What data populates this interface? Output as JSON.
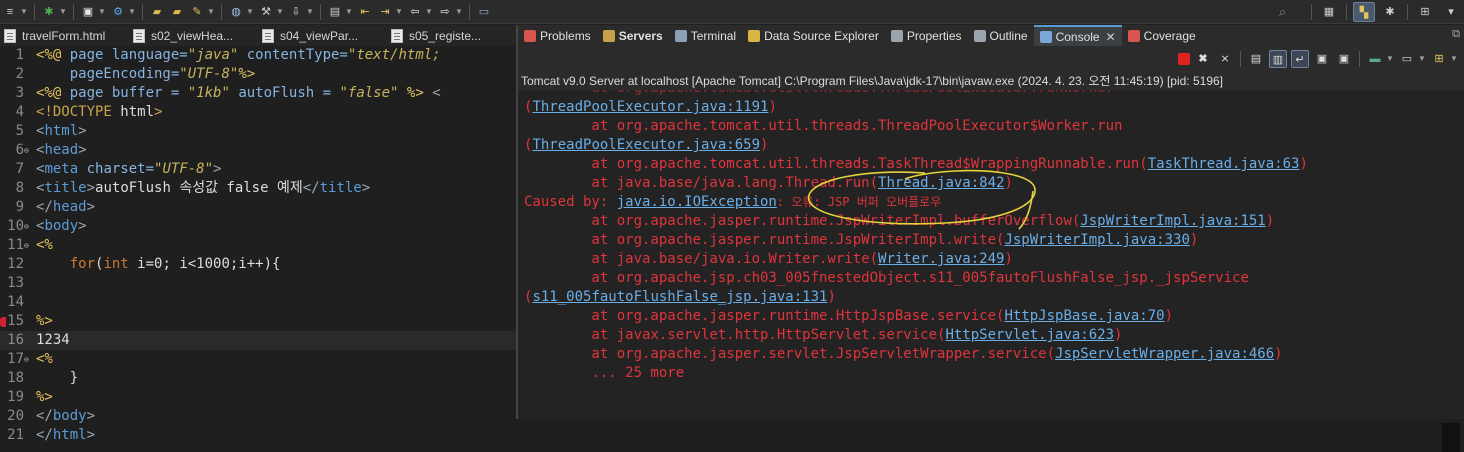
{
  "toolbar": {
    "left_icons": [
      "menu-icon",
      "debug-icon",
      "new-icon",
      "run-icon",
      "open-folder-icon",
      "open-file-icon",
      "brush-icon",
      "globe-icon",
      "tools-icon",
      "import-icon",
      "export-icon",
      "back-icon",
      "forward-icon",
      "prev-icon",
      "next-icon",
      "view-icon"
    ],
    "right_icons": [
      "search-icon",
      "perspective-icon",
      "java-ee-perspective-icon",
      "debug-perspective-icon",
      "add-perspective-icon",
      "more-icon"
    ]
  },
  "editor_tabs": [
    {
      "label": "travelForm.html"
    },
    {
      "label": "s02_viewHea..."
    },
    {
      "label": "s04_viewPar..."
    },
    {
      "label": "s05_registe..."
    }
  ],
  "editor": {
    "lines": [
      {
        "n": "1",
        "fold": "",
        "tokens": [
          [
            "k-jsp",
            "<%@ "
          ],
          [
            "k-attr",
            "page language="
          ],
          [
            "k-str",
            "\"java\""
          ],
          [
            "k-attr",
            " contentType="
          ],
          [
            "k-str",
            "\"text/html;"
          ]
        ]
      },
      {
        "n": "2",
        "fold": "",
        "tokens": [
          [
            "k-attr",
            "    pageEncoding="
          ],
          [
            "k-str",
            "\"UTF-8\""
          ],
          [
            "k-jsp",
            "%>"
          ]
        ]
      },
      {
        "n": "3",
        "fold": "",
        "tokens": [
          [
            "k-jsp",
            "<%@ "
          ],
          [
            "k-attr",
            "page buffer = "
          ],
          [
            "k-str",
            "\"1kb\""
          ],
          [
            "k-attr",
            " autoFlush = "
          ],
          [
            "k-str",
            "\"false\""
          ],
          [
            "k-jsp",
            " %> "
          ],
          [
            "k-tag",
            "<"
          ]
        ]
      },
      {
        "n": "4",
        "fold": "",
        "tokens": [
          [
            "k-doc",
            "<!DOCTYPE "
          ],
          [
            "k-plain",
            "html"
          ],
          [
            "k-doc",
            ">"
          ]
        ]
      },
      {
        "n": "5",
        "fold": "",
        "tokens": [
          [
            "k-tag",
            "<"
          ],
          [
            "k-elem",
            "html"
          ],
          [
            "k-tag",
            ">"
          ]
        ]
      },
      {
        "n": "6",
        "fold": "⊖",
        "tokens": [
          [
            "k-tag",
            "<"
          ],
          [
            "k-elem",
            "head"
          ],
          [
            "k-tag",
            ">"
          ]
        ]
      },
      {
        "n": "7",
        "fold": "",
        "tokens": [
          [
            "k-tag",
            "<"
          ],
          [
            "k-elem",
            "meta "
          ],
          [
            "k-attr",
            "charset="
          ],
          [
            "k-str",
            "\"UTF-8\""
          ],
          [
            "k-tag",
            ">"
          ]
        ]
      },
      {
        "n": "8",
        "fold": "",
        "tokens": [
          [
            "k-tag",
            "<"
          ],
          [
            "k-elem",
            "title"
          ],
          [
            "k-tag",
            ">"
          ],
          [
            "k-plain",
            "autoFlush 속성값 false 예제"
          ],
          [
            "k-tag",
            "</"
          ],
          [
            "k-elem",
            "title"
          ],
          [
            "k-tag",
            ">"
          ]
        ]
      },
      {
        "n": "9",
        "fold": "",
        "tokens": [
          [
            "k-tag",
            "</"
          ],
          [
            "k-elem",
            "head"
          ],
          [
            "k-tag",
            ">"
          ]
        ]
      },
      {
        "n": "10",
        "fold": "⊖",
        "tokens": [
          [
            "k-tag",
            "<"
          ],
          [
            "k-elem",
            "body"
          ],
          [
            "k-tag",
            ">"
          ]
        ]
      },
      {
        "n": "11",
        "fold": "⊖",
        "tokens": [
          [
            "k-jsp",
            "<%"
          ]
        ]
      },
      {
        "n": "12",
        "fold": "",
        "tokens": [
          [
            "k-plain",
            "    "
          ],
          [
            "k-kw",
            "for"
          ],
          [
            "k-plain",
            "("
          ],
          [
            "k-kw",
            "int"
          ],
          [
            "k-plain",
            " i=0; i<1000;i++){"
          ]
        ]
      },
      {
        "n": "13",
        "fold": "",
        "tokens": []
      },
      {
        "n": "14",
        "fold": "",
        "tokens": []
      },
      {
        "n": "15",
        "fold": "",
        "tokens": [
          [
            "k-jsp",
            "%>"
          ]
        ]
      },
      {
        "n": "16",
        "fold": "",
        "tokens": [
          [
            "k-plain",
            "1234"
          ]
        ]
      },
      {
        "n": "17",
        "fold": "⊖",
        "tokens": [
          [
            "k-jsp",
            "<%"
          ]
        ]
      },
      {
        "n": "18",
        "fold": "",
        "tokens": [
          [
            "k-plain",
            "    }"
          ]
        ]
      },
      {
        "n": "19",
        "fold": "",
        "tokens": [
          [
            "k-jsp",
            "%>"
          ]
        ]
      },
      {
        "n": "20",
        "fold": "",
        "tokens": [
          [
            "k-tag",
            "</"
          ],
          [
            "k-elem",
            "body"
          ],
          [
            "k-tag",
            ">"
          ]
        ]
      },
      {
        "n": "21",
        "fold": "",
        "tokens": [
          [
            "k-tag",
            "</"
          ],
          [
            "k-elem",
            "html"
          ],
          [
            "k-tag",
            ">"
          ]
        ]
      }
    ]
  },
  "view_tabs": [
    {
      "label": "Problems",
      "icon": "problems-icon",
      "color": "#d9534f"
    },
    {
      "label": "Servers",
      "icon": "servers-icon",
      "color": "#c8a24a"
    },
    {
      "label": "Terminal",
      "icon": "terminal-icon",
      "color": "#8aa0b8"
    },
    {
      "label": "Data Source Explorer",
      "icon": "data-source-icon",
      "color": "#d8b840"
    },
    {
      "label": "Properties",
      "icon": "properties-icon",
      "color": "#9aa5b0"
    },
    {
      "label": "Outline",
      "icon": "outline-icon",
      "color": "#9aa5b0"
    },
    {
      "label": "Console",
      "icon": "console-icon",
      "color": "#7aa7d8"
    },
    {
      "label": "Coverage",
      "icon": "coverage-icon",
      "color": "#d9534f"
    }
  ],
  "console": {
    "header": "Tomcat v9.0 Server at localhost [Apache Tomcat] C:\\Program Files\\Java\\jdk-17\\bin\\javaw.exe  (2024. 4. 23. 오전 11:45:19) [pid: 5196]",
    "lines": [
      [
        [
          "t",
          "(",
          ""
        ],
        [
          "l",
          "ThreadPoolExecutor.java:1191"
        ],
        [
          "t",
          ")",
          ""
        ]
      ],
      [
        [
          "t",
          "        at org.apache.tomcat.util.threads.ThreadPoolExecutor$Worker.run",
          ""
        ]
      ],
      [
        [
          "t",
          "(",
          ""
        ],
        [
          "l",
          "ThreadPoolExecutor.java:659"
        ],
        [
          "t",
          ")",
          ""
        ]
      ],
      [
        [
          "t",
          "        at org.apache.tomcat.util.threads.TaskThread$WrappingRunnable.run(",
          ""
        ],
        [
          "l",
          "TaskThread.java:63"
        ],
        [
          "t",
          ")",
          ""
        ]
      ],
      [
        [
          "t",
          "        at java.base/java.lang.Thread.run(",
          ""
        ],
        [
          "l",
          "Thread.java:842"
        ],
        [
          "t",
          ")",
          ""
        ]
      ],
      [
        [
          "t",
          "Caused by: ",
          ""
        ],
        [
          "l",
          "java.io.IOException"
        ],
        [
          "m",
          ": 오류: JSP 버퍼 오버플로우"
        ]
      ],
      [
        [
          "t",
          "        at org.apache.jasper.runtime.JspWriterImpl.bufferOverflow(",
          ""
        ],
        [
          "l",
          "JspWriterImpl.java:151"
        ],
        [
          "t",
          ")",
          ""
        ]
      ],
      [
        [
          "t",
          "        at org.apache.jasper.runtime.JspWriterImpl.write(",
          ""
        ],
        [
          "l",
          "JspWriterImpl.java:330"
        ],
        [
          "t",
          ")",
          ""
        ]
      ],
      [
        [
          "t",
          "        at java.base/java.io.Writer.write(",
          ""
        ],
        [
          "l",
          "Writer.java:249"
        ],
        [
          "t",
          ")",
          ""
        ]
      ],
      [
        [
          "t",
          "        at org.apache.jsp.ch03_005fnestedObject.s11_005fautoFlushFalse_jsp._jspService",
          ""
        ]
      ],
      [
        [
          "t",
          "(",
          ""
        ],
        [
          "l",
          "s11_005fautoFlushFalse_jsp.java:131"
        ],
        [
          "t",
          ")",
          ""
        ]
      ],
      [
        [
          "t",
          "        at org.apache.jasper.runtime.HttpJspBase.service(",
          ""
        ],
        [
          "l",
          "HttpJspBase.java:70"
        ],
        [
          "t",
          ")",
          ""
        ]
      ],
      [
        [
          "t",
          "        at javax.servlet.http.HttpServlet.service(",
          ""
        ],
        [
          "l",
          "HttpServlet.java:623"
        ],
        [
          "t",
          ")",
          ""
        ]
      ],
      [
        [
          "t",
          "        at org.apache.jasper.servlet.JspServletWrapper.service(",
          ""
        ],
        [
          "l",
          "JspServletWrapper.java:466"
        ],
        [
          "t",
          ")",
          ""
        ]
      ],
      [
        [
          "t",
          "        ... 25 more",
          ""
        ]
      ]
    ]
  },
  "colors": {
    "error_text": "#e0343c",
    "link_text": "#6aaee8",
    "annotation": "#e8d23a",
    "active_tab_accent": "#5b9bd5"
  }
}
